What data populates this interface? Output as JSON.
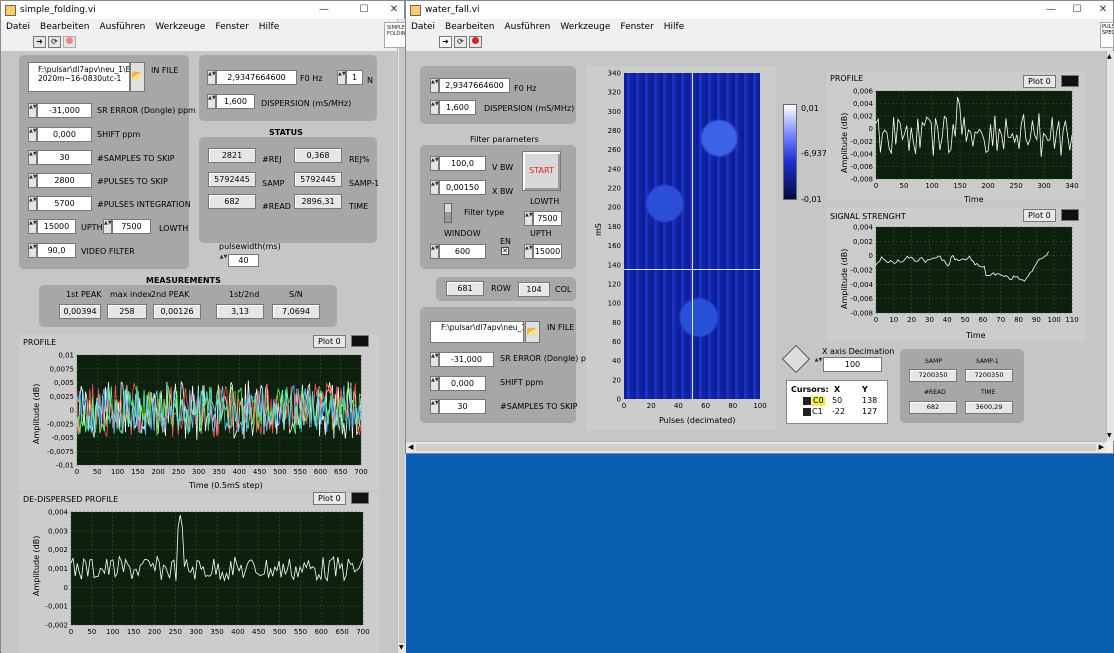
{
  "left_window": {
    "title": "simple_folding.vi",
    "menu": [
      "Datei",
      "Bearbeiten",
      "Ausführen",
      "Werkzeuge",
      "Fenster",
      "Hilfe"
    ],
    "controls": {
      "in_file_path": "F:\\pulsar\\dl7apv\\neu_1\\B0450+55-2020m~16-0830utc-1",
      "in_file_label": "IN FILE",
      "sr_error": "-31,000",
      "sr_error_label": "SR ERROR (Dongle) ppm",
      "shift": "0,000",
      "shift_label": "SHIFT ppm",
      "samples_skip": "30",
      "samples_skip_label": "#SAMPLES TO SKIP",
      "pulses_skip": "2800",
      "pulses_skip_label": "#PULSES TO SKIP",
      "pulses_int": "5700",
      "pulses_int_label": "#PULSES INTEGRATION",
      "upth": "15000",
      "upth_label": "UPTH",
      "lowth": "7500",
      "lowth_label": "LOWTH",
      "video_filter": "90,0",
      "video_filter_label": "VIDEO FILTER",
      "f0": "2,9347664600",
      "f0_label": "F0 Hz",
      "n": "1",
      "n_label": "N",
      "dispersion": "1,600",
      "dispersion_label": "DISPERSION (mS/MHz)",
      "pulsewidth_label": "pulsewidth(ms)",
      "pulsewidth": "40"
    },
    "status": {
      "title": "STATUS",
      "rej": "2821",
      "rej_label": "#REJ",
      "rej_pct": "0,368",
      "rej_pct_label": "REJ%",
      "samp": "5792445",
      "samp_label": "SAMP",
      "samp1": "5792445",
      "samp1_label": "SAMP-1",
      "read": "682",
      "read_label": "#READ",
      "time": "2896,31",
      "time_label": "TIME"
    },
    "measurements": {
      "title": "MEASUREMENTS",
      "peak1_label": "1st PEAK",
      "peak1": "0,00394",
      "maxidx_label": "max index",
      "maxidx": "258",
      "peak2_label": "2nd PEAK",
      "peak2": "0,00126",
      "ratio_label": "1st/2nd",
      "ratio": "3,13",
      "sn_label": "S/N",
      "sn": "7,0694"
    },
    "profile": {
      "title": "PROFILE",
      "plot_label": "Plot 0",
      "ylabel": "Amplitude (dB)",
      "xlabel": "Time (0.5mS step)",
      "yticks": [
        "0,01",
        "0,0075",
        "0,005",
        "0,0025",
        "0",
        "-0,0025",
        "-0,005",
        "-0,0075",
        "-0,01"
      ],
      "xticks": [
        "0",
        "50",
        "100",
        "150",
        "200",
        "250",
        "300",
        "350",
        "400",
        "450",
        "500",
        "550",
        "600",
        "650",
        "700"
      ]
    },
    "dedispersed": {
      "title": "DE-DISPERSED PROFILE",
      "plot_label": "Plot 0",
      "ylabel": "Amplitude (dB)",
      "yticks": [
        "0,004",
        "0,003",
        "0,002",
        "0,001",
        "0",
        "-0,001",
        "-0,002"
      ],
      "xticks": [
        "0",
        "50",
        "100",
        "150",
        "200",
        "250",
        "300",
        "350",
        "400",
        "450",
        "500",
        "550",
        "600",
        "650",
        "700"
      ]
    }
  },
  "right_window": {
    "title": "water_fall.vi",
    "menu": [
      "Datei",
      "Bearbeiten",
      "Ausführen",
      "Werkzeuge",
      "Fenster",
      "Hilfe"
    ],
    "controls": {
      "f0": "2,9347664600",
      "f0_label": "F0 Hz",
      "dispersion": "1,600",
      "dispersion_label": "DISPERSION (mS/MHz)",
      "filter_title": "Filter parameters",
      "vbw": "100,0",
      "vbw_label": "V BW",
      "xbw": "0,00150",
      "xbw_label": "X BW",
      "start_label": "START",
      "filter_type_label": "Filter type",
      "lowth_label": "LOWTH",
      "lowth": "7500",
      "window_label": "WINDOW",
      "window": "600",
      "en_label": "EN",
      "upth_label": "UPTH",
      "upth": "15000",
      "row": "681",
      "row_label": "ROW",
      "col": "104",
      "col_label": "COL",
      "in_file_path": "F:\\pulsar\\dl7apv\\neu_1\\B0450+",
      "in_file_label": "IN FILE",
      "sr_error": "-31,000",
      "sr_error_label": "SR ERROR (Dongle) ppm",
      "shift": "0,000",
      "shift_label": "SHIFT ppm",
      "samples_skip": "30",
      "samples_skip_label": "#SAMPLES TO SKIP"
    },
    "waterfall": {
      "ylabel": "mS",
      "xlabel": "Pulses (decimated)",
      "yticks": [
        "340",
        "320",
        "300",
        "280",
        "260",
        "240",
        "220",
        "200",
        "180",
        "160",
        "140",
        "120",
        "100",
        "80",
        "60",
        "40",
        "20",
        "0"
      ],
      "xticks": [
        "0",
        "20",
        "40",
        "60",
        "80",
        "100"
      ],
      "scale": [
        "0,01",
        "-6,9372E",
        "-0,01"
      ]
    },
    "x_decimation_label": "X axis Decimation",
    "x_decimation": "100",
    "cursors": {
      "header": [
        "Cursors:",
        "X",
        "Y"
      ],
      "rows": [
        {
          "name": "C0",
          "x": "50",
          "y": "138"
        },
        {
          "name": "C1",
          "x": "-22",
          "y": "127"
        }
      ]
    },
    "stats": {
      "samp_label": "SAMP",
      "samp": "7200350",
      "samp1_label": "SAMP-1",
      "samp1": "7200350",
      "read_label": "#READ",
      "read": "682",
      "time_label": "TIME",
      "time": "3600,29"
    },
    "profile": {
      "title": "PROFILE",
      "plot_label": "Plot 0",
      "ylabel": "Amplitude (dB)",
      "xlabel": "Time",
      "yticks": [
        "0,006",
        "0,004",
        "0,002",
        "0",
        "-0,002",
        "-0,004",
        "-0,006",
        "-0,008"
      ],
      "xticks": [
        "0",
        "50",
        "100",
        "150",
        "200",
        "250",
        "300",
        "340"
      ]
    },
    "signal": {
      "title": "SIGNAL STRENGHT",
      "plot_label": "Plot 0",
      "ylabel": "Amplitude (dB)",
      "xlabel": "Time",
      "yticks": [
        "0,004",
        "0,002",
        "0",
        "-0,002",
        "-0,004",
        "-0,006",
        "-0,008"
      ],
      "xticks": [
        "0",
        "10",
        "20",
        "30",
        "40",
        "50",
        "60",
        "70",
        "80",
        "90",
        "100",
        "110"
      ]
    }
  },
  "strip": {
    "left_label": "SIMPLE FOLDING",
    "right_label": "PULSAR SPECT"
  }
}
